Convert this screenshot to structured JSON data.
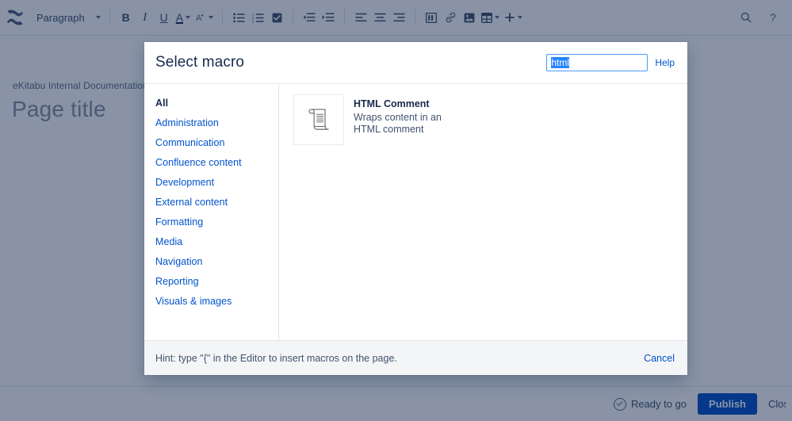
{
  "toolbar": {
    "logo_icon": "confluence-logo-icon",
    "style_select": {
      "label": "Paragraph",
      "caret_icon": "chevron-down-icon"
    },
    "groups": [
      {
        "name": "text-format",
        "buttons": [
          {
            "name": "bold-button",
            "label": "B",
            "icon": "bold-icon"
          },
          {
            "name": "italic-button",
            "label": "I",
            "icon": "italic-icon"
          },
          {
            "name": "underline-button",
            "label": "U",
            "icon": "underline-icon"
          },
          {
            "name": "text-color-button",
            "label": "A",
            "icon": "text-color-icon",
            "caret": true
          },
          {
            "name": "text-effects-button",
            "label": "A",
            "icon": "text-effects-icon",
            "caret": true
          }
        ]
      },
      {
        "name": "lists",
        "buttons": [
          {
            "name": "bullet-list-button",
            "icon": "bullet-list-icon"
          },
          {
            "name": "numbered-list-button",
            "icon": "numbered-list-icon"
          },
          {
            "name": "task-list-button",
            "icon": "task-list-icon"
          }
        ]
      },
      {
        "name": "indent",
        "buttons": [
          {
            "name": "outdent-button",
            "icon": "outdent-icon"
          },
          {
            "name": "indent-button",
            "icon": "indent-icon"
          }
        ]
      },
      {
        "name": "align",
        "buttons": [
          {
            "name": "align-left-button",
            "icon": "align-left-icon"
          },
          {
            "name": "align-center-button",
            "icon": "align-center-icon"
          },
          {
            "name": "align-right-button",
            "icon": "align-right-icon"
          }
        ]
      },
      {
        "name": "insert",
        "buttons": [
          {
            "name": "page-layout-button",
            "icon": "page-layout-icon"
          },
          {
            "name": "link-button",
            "icon": "link-icon"
          },
          {
            "name": "image-button",
            "icon": "image-icon"
          },
          {
            "name": "table-button",
            "icon": "table-icon",
            "caret": true
          },
          {
            "name": "insert-more-button",
            "icon": "plus-icon",
            "caret": true
          }
        ]
      }
    ],
    "right_icons": [
      {
        "name": "search-icon",
        "glyph": "search"
      },
      {
        "name": "help-icon",
        "glyph": "question"
      }
    ]
  },
  "page": {
    "breadcrumb": {
      "space": "eKitabu Internal Documentation",
      "separator": "/"
    },
    "title": "Page title"
  },
  "bottom_bar": {
    "status_icon": "check-circle-icon",
    "status_text": "Ready to go",
    "publish_label": "Publish",
    "close_label": "Close"
  },
  "modal": {
    "title": "Select macro",
    "search": {
      "value": "html",
      "placeholder": "",
      "selected": true
    },
    "help_label": "Help",
    "categories": [
      {
        "label": "All",
        "selected": true
      },
      {
        "label": "Administration",
        "selected": false
      },
      {
        "label": "Communication",
        "selected": false
      },
      {
        "label": "Confluence content",
        "selected": false
      },
      {
        "label": "Development",
        "selected": false
      },
      {
        "label": "External content",
        "selected": false
      },
      {
        "label": "Formatting",
        "selected": false
      },
      {
        "label": "Media",
        "selected": false
      },
      {
        "label": "Navigation",
        "selected": false
      },
      {
        "label": "Reporting",
        "selected": false
      },
      {
        "label": "Visuals & images",
        "selected": false
      }
    ],
    "results": [
      {
        "icon": "scroll-document-icon",
        "name": "HTML Comment",
        "description": "Wraps content in an HTML comment"
      }
    ],
    "footer": {
      "hint": "Hint: type \"{\" in the Editor to insert macros on the page.",
      "cancel_label": "Cancel"
    }
  },
  "colors": {
    "accent": "#0052cc",
    "text": "#172b4d",
    "subtle_text": "#42526e",
    "overlay": "#091e42",
    "focus_border": "#4c9aff",
    "selection": "#2684ff"
  }
}
